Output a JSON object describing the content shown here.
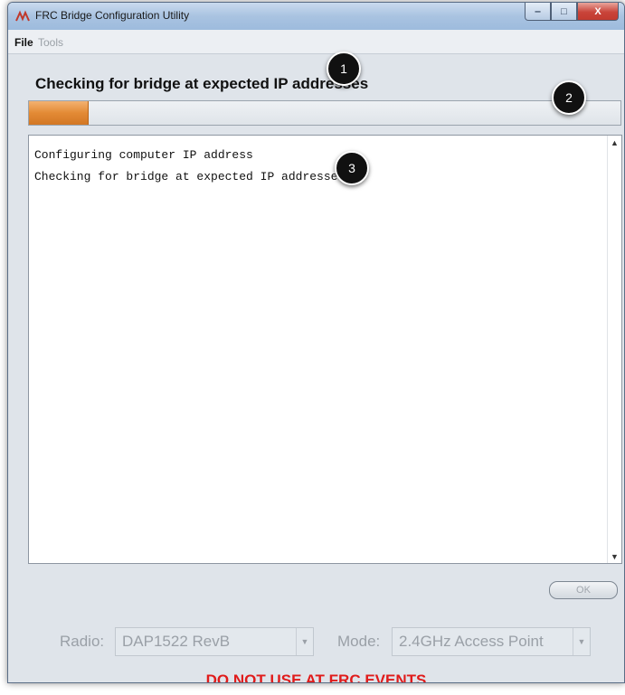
{
  "window": {
    "title": "FRC Bridge Configuration Utility",
    "buttons": {
      "minimize": "‒",
      "maximize": "□",
      "close": "X"
    }
  },
  "menu": {
    "file": "File",
    "tools": "Tools"
  },
  "status_heading": "Checking for bridge at expected IP addresses",
  "progress": {
    "fraction": 0.1,
    "fill_color": "#e38a35"
  },
  "log": {
    "lines": [
      "Configuring computer IP address",
      "Checking for bridge at expected IP addresses"
    ]
  },
  "ok_button": "OK",
  "radio": {
    "label": "Radio:",
    "value": "DAP1522 RevB"
  },
  "mode": {
    "label": "Mode:",
    "value": "2.4GHz Access Point"
  },
  "warning": "DO NOT USE AT FRC EVENTS",
  "annotations": [
    "1",
    "2",
    "3"
  ],
  "colors": {
    "warning": "#e01b1b",
    "progress": "#e38a35"
  }
}
